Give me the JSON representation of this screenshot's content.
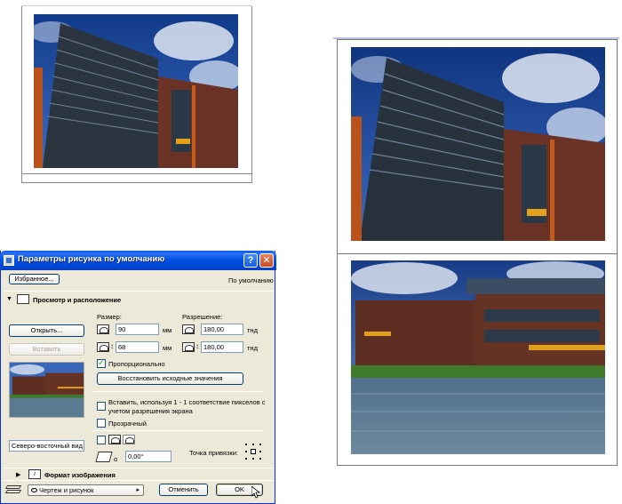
{
  "dialog": {
    "title": "Параметры рисунка по умолчанию",
    "help_button": "?",
    "close_button": "✕",
    "favorites_button": "Избранное...",
    "default_label": "По умолчанию",
    "section_view": "Просмотр и расположение",
    "section_format": "Формат изображения",
    "open_button": "Открыть...",
    "insert_button": "Вставить",
    "size_label": "Размер:",
    "resolution_label": "Разрешение:",
    "width_value": "90",
    "height_value": "68",
    "mm_unit_1": "мм",
    "mm_unit_2": "мм",
    "res_x_value": "180,00",
    "res_y_value": "180,00",
    "dpi_unit_1": "тнд",
    "dpi_unit_2": "тнд",
    "proportional_label": "Пропорционально",
    "proportional_checked": true,
    "restore_button": "Восстановить исходные значения",
    "pixel_insert_label_1": "Вставить, используя 1 - 1 соответствие пикселов с",
    "pixel_insert_label_2": "учетом разрешения экрана",
    "transparent_label": "Прозрачный",
    "view_name_value": "Северо-восточный вид",
    "angle_value": "0,00°",
    "angle_symbol": "α",
    "anchor_label": "Точка привязки:",
    "layer_select_value": "Чертеж и рисунок",
    "cancel_button": "Отменить",
    "ok_button": "OK"
  },
  "colors": {
    "titlebar_blue": "#0054e3",
    "dialog_face": "#ece9d8",
    "ok_focus": "#f5c16a"
  }
}
